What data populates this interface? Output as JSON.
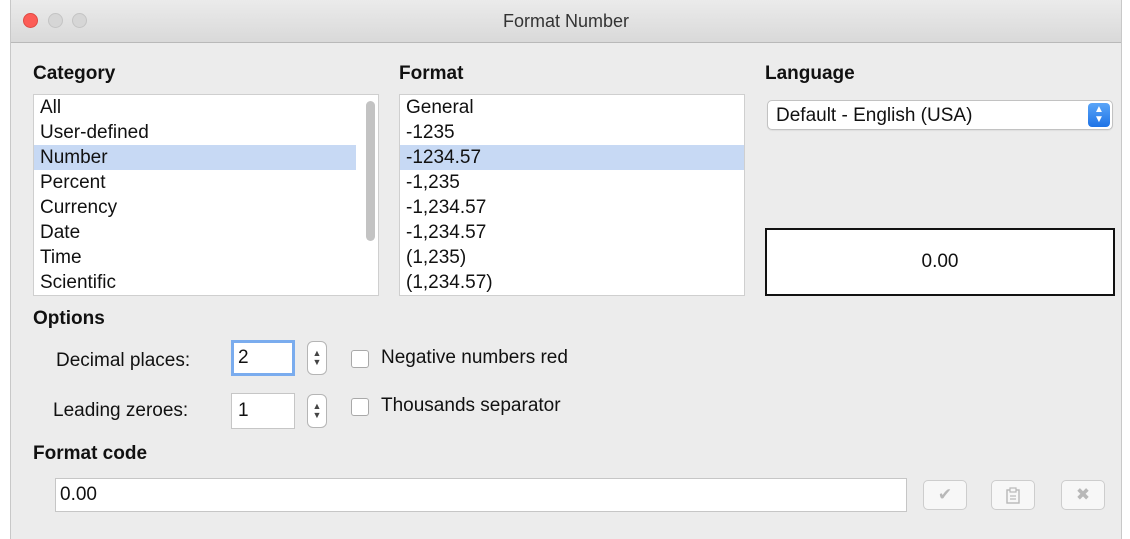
{
  "window": {
    "title": "Format Number"
  },
  "category": {
    "heading": "Category",
    "items": [
      "All",
      "User-defined",
      "Number",
      "Percent",
      "Currency",
      "Date",
      "Time",
      "Scientific"
    ],
    "selected": "Number"
  },
  "format": {
    "heading": "Format",
    "items": [
      "General",
      "-1235",
      "-1234.57",
      "-1,235",
      "-1,234.57",
      "-1,234.57",
      "(1,235)",
      "(1,234.57)"
    ],
    "selected": "-1234.57"
  },
  "language": {
    "heading": "Language",
    "value": "Default - English (USA)"
  },
  "preview": {
    "value": "0.00"
  },
  "options": {
    "heading": "Options",
    "decimal_places_label": "Decimal places:",
    "decimal_places_value": "2",
    "leading_zeroes_label": "Leading zeroes:",
    "leading_zeroes_value": "1",
    "negative_red_label": "Negative numbers red",
    "thousands_sep_label": "Thousands separator"
  },
  "format_code": {
    "heading": "Format code",
    "value": "0.00"
  },
  "icons": {
    "accept": "checkmark-icon",
    "comment": "edit-comment-icon",
    "delete": "delete-x-icon"
  }
}
